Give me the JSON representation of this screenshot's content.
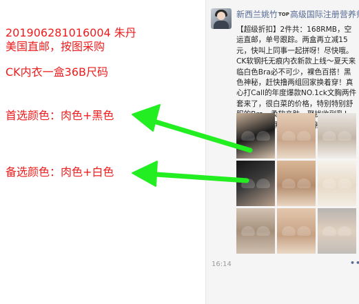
{
  "notes": {
    "order_line": "201906281016004   朱丹",
    "shipping_line": "美国直邮，按图采购",
    "product_line": "CK内衣一盒36B尺码",
    "first_choice": "首选颜色：肉色+黑色",
    "backup_choice": "备选颜色：肉色+白色",
    "text_color": "#ee1c1c",
    "arrow_color": "#22ee22"
  },
  "post": {
    "author": "新西兰姚竹",
    "badge": "TOP",
    "author_title": "高级国际注册营养师",
    "text": "【超级折扣】2件共：168RMB，空运直邮，单号跟踪。两盒再立减15元，快叫上同事一起拼呀！尽快哦。CK软钢托无痕内衣新款上线～夏天来临白色Bra必不可少，裸色百搭！黑色神秘，赶快撸两组回家换着穿！真心打Call的年度爆款NO.1ck文胸两件套来了，很白菜的价格，特别特别舒服的Bra，柔软亲肤，聚拢收副乳！两色可选：黑+裸，白+裸！",
    "time": "16:14",
    "photo_count": 9
  },
  "icons": {
    "avatar": "avatar-photo",
    "arrow": "green-arrow-left",
    "more": "more-dots-icon"
  }
}
